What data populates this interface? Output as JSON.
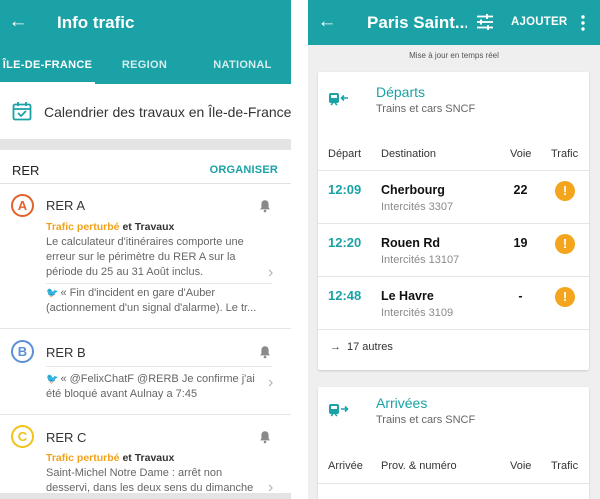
{
  "left": {
    "title": "Info trafic",
    "tabs": [
      {
        "label": "ÎLE-DE-FRANCE",
        "active": true
      },
      {
        "label": "REGION",
        "active": false
      },
      {
        "label": "NATIONAL",
        "active": false
      }
    ],
    "calendar_label": "Calendrier des travaux en Île-de-France",
    "section": {
      "title": "RER",
      "action": "ORGANISER"
    },
    "lines": [
      {
        "badge": "A",
        "color": "#e3622a",
        "name": "RER A",
        "status_main": "Trafic perturbé",
        "status_extra": " et Travaux",
        "message": "Le calculateur d'itinéraires comporte une erreur sur le périmètre du RER A sur la période du 25 au 31 Août inclus.",
        "tweet": "« Fin d'incident en gare d'Auber (actionnement d'un signal d'alarme). Le tr..."
      },
      {
        "badge": "B",
        "color": "#5b8fd6",
        "name": "RER B",
        "tweet": "« @FelixChatF @RERB Je confirme j'ai été bloqué avant Aulnay a 7:45"
      },
      {
        "badge": "C",
        "color": "#f0c21a",
        "name": "RER C",
        "status_main": "Trafic perturbé",
        "status_extra": " et Travaux",
        "message": "Saint-Michel Notre Dame : arrêt non desservi, dans les deux sens du dimanche"
      }
    ],
    "colors": {
      "primary": "#1aa2a6",
      "warning": "#f0a21c"
    }
  },
  "right": {
    "title": "Paris Saint...",
    "add_label": "AJOUTER",
    "update_text": "Mise à jour en temps réel",
    "departures": {
      "title": "Départs",
      "subtitle": "Trains et cars SNCF",
      "columns": [
        "Départ",
        "Destination",
        "Voie",
        "Trafic"
      ],
      "rows": [
        {
          "time": "12:09",
          "destination": "Cherbourg",
          "train": "Intercités 3307",
          "voie": "22"
        },
        {
          "time": "12:20",
          "destination": "Rouen Rd",
          "train": "Intercités 13107",
          "voie": "19"
        },
        {
          "time": "12:48",
          "destination": "Le Havre",
          "train": "Intercités 3109",
          "voie": "-"
        }
      ],
      "more": "17 autres"
    },
    "arrivals": {
      "title": "Arrivées",
      "subtitle": "Trains et cars SNCF",
      "columns": [
        "Arrivée",
        "Prov. & numéro",
        "Voie",
        "Trafic"
      ]
    }
  }
}
